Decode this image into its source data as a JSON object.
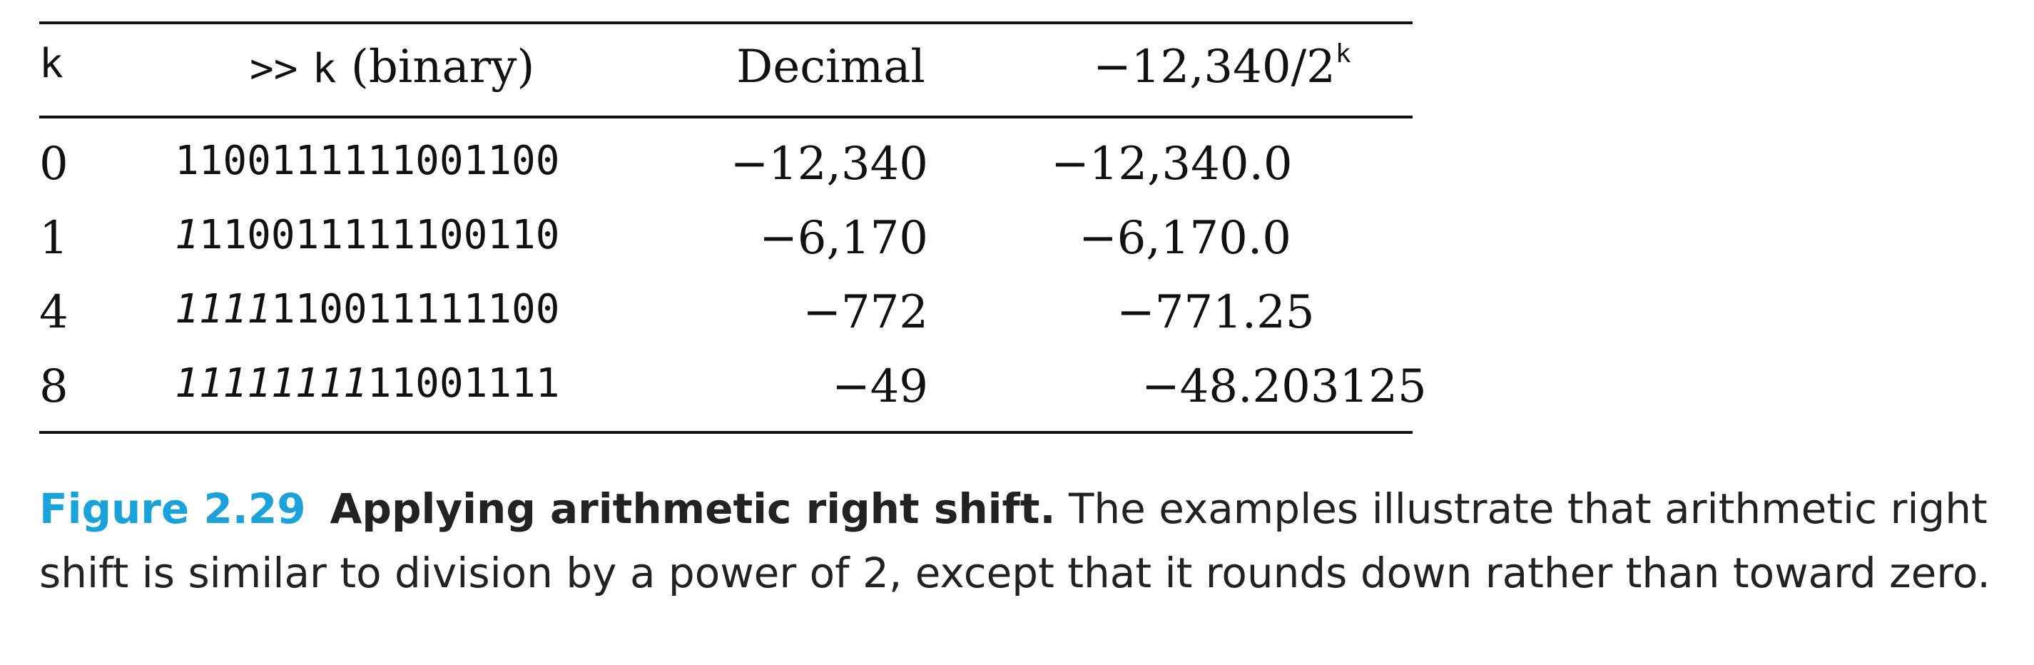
{
  "table": {
    "header": {
      "k": "k",
      "shift_op": ">>",
      "shift_var": "k",
      "shift_suffix": "(binary)",
      "decimal": "Decimal",
      "division": "−12,340/2",
      "division_exp": "k"
    },
    "rows": [
      {
        "k": "0",
        "binary_shifted": "",
        "binary_rest": "1100111111001100",
        "decimal": "−12,340",
        "division": "−12,340.0"
      },
      {
        "k": "1",
        "binary_shifted": "1",
        "binary_rest": "110011111100110",
        "decimal": "−6,170",
        "division": "−6,170.0"
      },
      {
        "k": "4",
        "binary_shifted": "1111",
        "binary_rest": "110011111100",
        "decimal": "−772",
        "division": "−771.25"
      },
      {
        "k": "8",
        "binary_shifted": "11111111",
        "binary_rest": "11001111",
        "decimal": "−49",
        "division": "−48.203125"
      }
    ]
  },
  "caption": {
    "label": "Figure 2.29",
    "title": "Applying arithmetic right shift.",
    "text": " The examples illustrate that arithmetic right shift is similar to division by a power of 2, except that it rounds down rather than toward zero."
  }
}
